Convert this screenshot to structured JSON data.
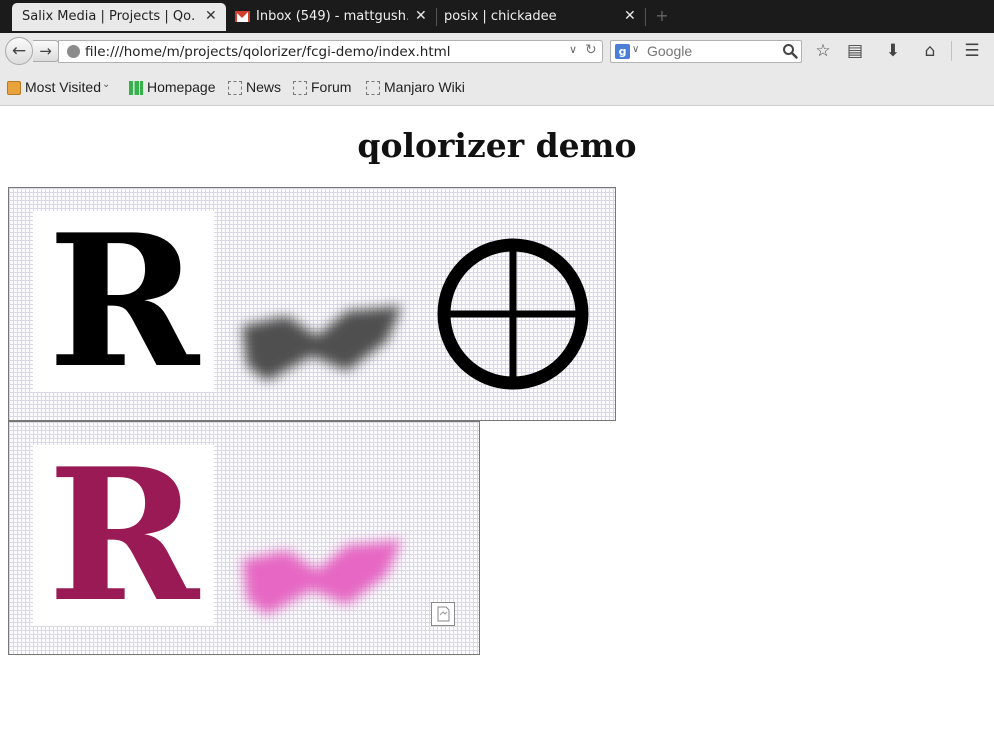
{
  "browser": {
    "tabs": [
      {
        "title": "Salix Media | Projects | Qo…",
        "active": true
      },
      {
        "title": "Inbox (549) - mattgush…",
        "icon": "gmail-icon",
        "active": false
      },
      {
        "title": "posix | chickadee",
        "active": false
      }
    ],
    "tab_close_glyph": "✕",
    "new_tab_glyph": "+",
    "url": "file:///home/m/projects/qolorizer/fcgi-demo/index.html",
    "search": {
      "placeholder": "Google",
      "engine_letter": "g"
    },
    "bookmarks": [
      {
        "label": "Most Visited",
        "icon": "folder-icon",
        "has_dropdown": true
      },
      {
        "label": "Homepage",
        "icon": "manjaro-icon"
      },
      {
        "label": "News",
        "icon": "dashed-page-icon"
      },
      {
        "label": "Forum",
        "icon": "dashed-page-icon"
      },
      {
        "label": "Manjaro Wiki",
        "icon": "dashed-page-icon"
      }
    ],
    "icons": {
      "back": "←",
      "forward": "→",
      "star": "☆",
      "reading_list": "▤",
      "download": "⬇",
      "home": "⌂",
      "menu": "☰",
      "reload": "↻",
      "dropdown": "∨",
      "chevron": "⌄"
    }
  },
  "page": {
    "title": "qolorizer demo",
    "panels": [
      {
        "letter": "R",
        "letter_color": "#000000",
        "smudge_color": "#3a3a3a",
        "has_circle_symbol": true
      },
      {
        "letter": "R",
        "letter_color": "#9a1a55",
        "smudge_color": "#e040b8",
        "has_broken_image": true
      }
    ]
  }
}
